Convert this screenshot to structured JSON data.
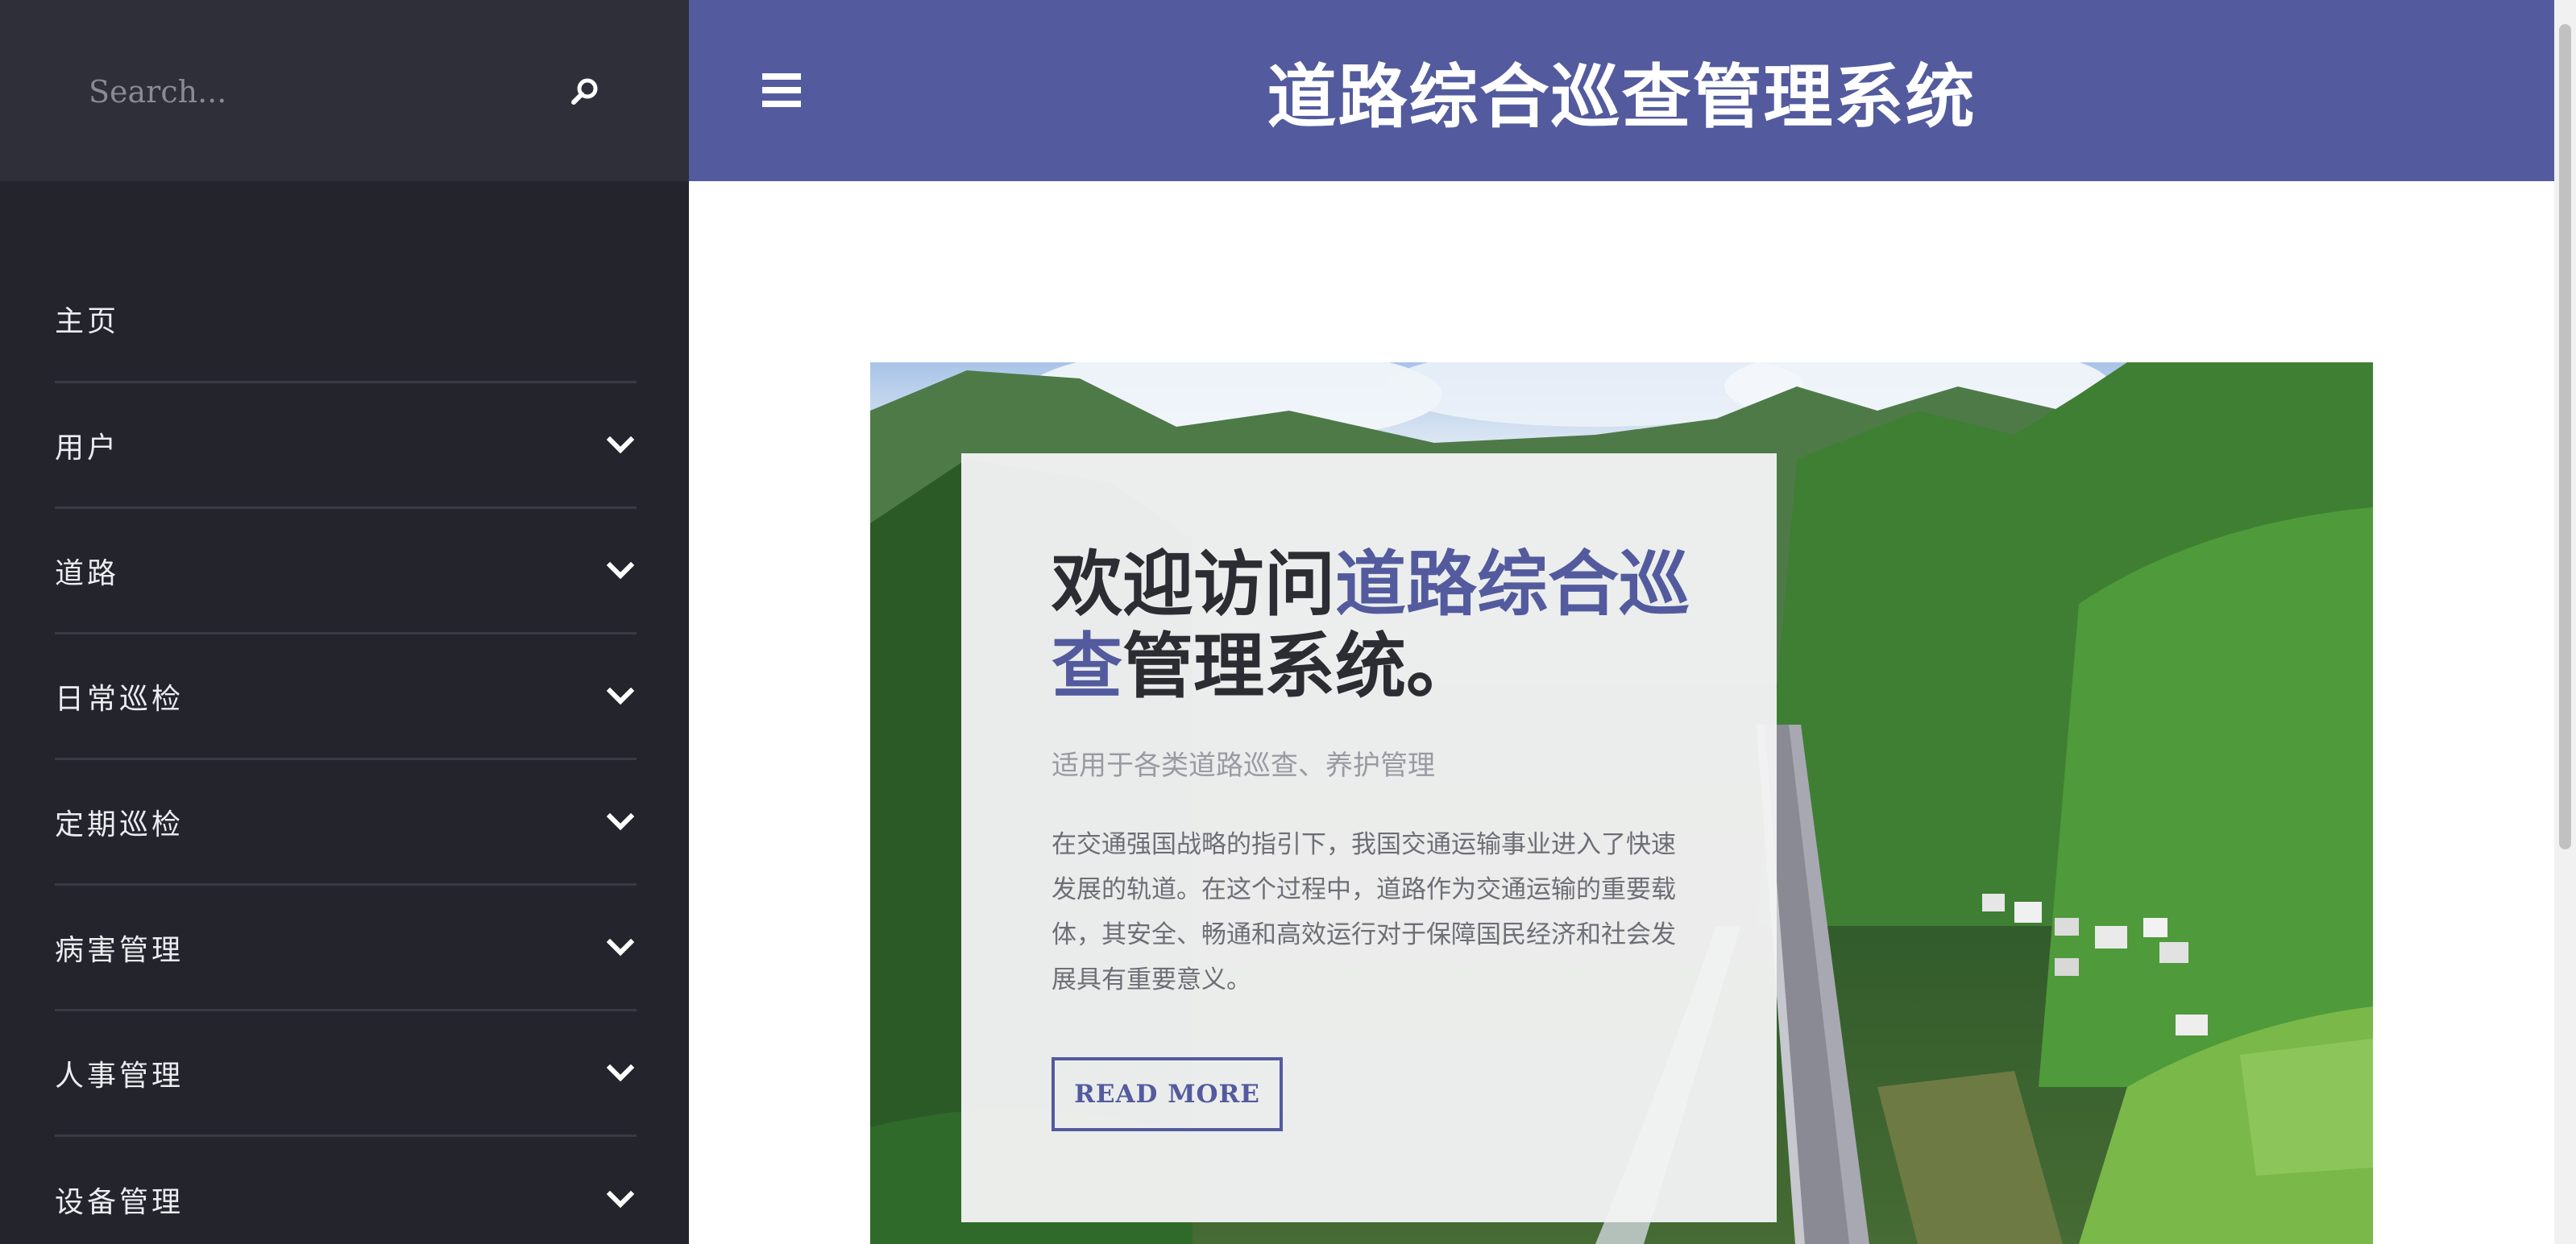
{
  "search": {
    "placeholder": "Search..."
  },
  "header": {
    "title": "道路综合巡查管理系统"
  },
  "sidebar": {
    "items": [
      {
        "label": "主页",
        "has_submenu": false
      },
      {
        "label": "用户",
        "has_submenu": true
      },
      {
        "label": "道路",
        "has_submenu": true
      },
      {
        "label": "日常巡检",
        "has_submenu": true
      },
      {
        "label": "定期巡检",
        "has_submenu": true
      },
      {
        "label": "病害管理",
        "has_submenu": true
      },
      {
        "label": "人事管理",
        "has_submenu": true
      },
      {
        "label": "设备管理",
        "has_submenu": true
      }
    ]
  },
  "hero": {
    "title_prefix": "欢迎访问",
    "title_highlight": "道路综合巡查",
    "title_suffix": "管理系统。",
    "subtitle": "适用于各类道路巡查、养护管理",
    "body": "在交通强国战略的指引下，我国交通运输事业进入了快速发展的轨道。在这个过程中，道路作为交通运输的重要载体，其安全、畅通和高效运行对于保障国民经济和社会发展具有重要意义。",
    "button_label": "READ MORE"
  },
  "icons": {
    "search": "search-icon",
    "menu": "hamburger-menu-icon",
    "submenu": "chevron-down-icon"
  },
  "colors": {
    "accent": "#535b9e",
    "sidebar_bg": "#24242d",
    "search_bg": "#2f2f39",
    "card_bg": "#f2f2f4"
  }
}
